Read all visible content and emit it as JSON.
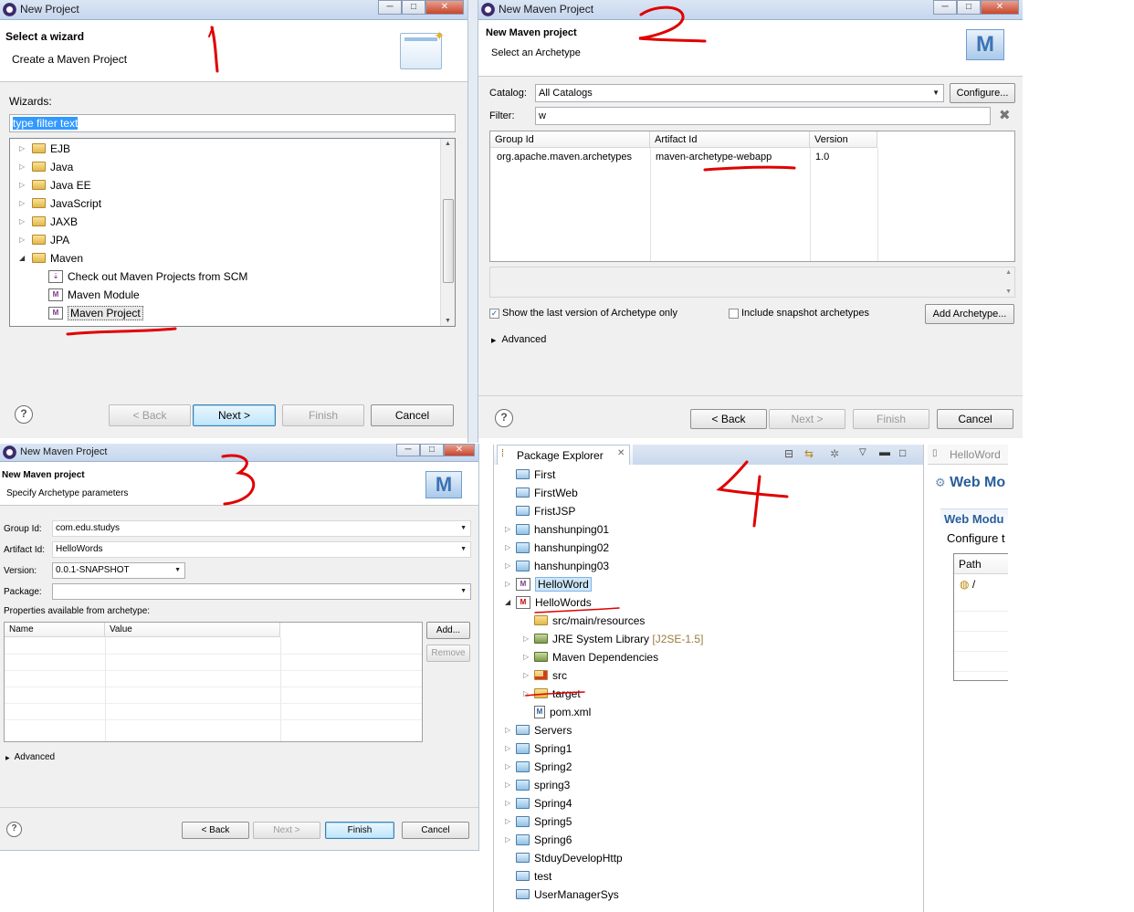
{
  "dialog1": {
    "title": "New Project",
    "banner_title": "Select a wizard",
    "banner_sub": "Create a Maven Project",
    "wizards_label": "Wizards:",
    "filter_value": "type filter text",
    "tree": [
      "EJB",
      "Java",
      "Java EE",
      "JavaScript",
      "JAXB",
      "JPA",
      "Maven"
    ],
    "maven_children": [
      "Check out Maven Projects from SCM",
      "Maven Module",
      "Maven Project"
    ],
    "buttons": {
      "back": "< Back",
      "next": "Next >",
      "finish": "Finish",
      "cancel": "Cancel"
    }
  },
  "dialog2": {
    "title": "New Maven Project",
    "banner_title": "New Maven project",
    "banner_sub": "Select an Archetype",
    "catalog_label": "Catalog:",
    "catalog_value": "All Catalogs",
    "configure": "Configure...",
    "filter_label": "Filter:",
    "filter_value": "w",
    "columns": [
      "Group Id",
      "Artifact Id",
      "Version"
    ],
    "row": {
      "group": "org.apache.maven.archetypes",
      "artifact": "maven-archetype-webapp",
      "version": "1.0"
    },
    "show_last": "Show the last version of Archetype only",
    "include_snap": "Include snapshot archetypes",
    "add_archetype": "Add Archetype...",
    "advanced": "Advanced",
    "buttons": {
      "back": "< Back",
      "next": "Next >",
      "finish": "Finish",
      "cancel": "Cancel"
    }
  },
  "dialog3": {
    "title": "New Maven Project",
    "banner_title": "New Maven project",
    "banner_sub": "Specify Archetype parameters",
    "group_label": "Group Id:",
    "group_value": "com.edu.studys",
    "artifact_label": "Artifact Id:",
    "artifact_value": "HelloWords",
    "version_label": "Version:",
    "version_value": "0.0.1-SNAPSHOT",
    "package_label": "Package:",
    "package_value": "",
    "props_label": "Properties available from archetype:",
    "columns": [
      "Name",
      "Value"
    ],
    "add": "Add...",
    "remove": "Remove",
    "advanced": "Advanced",
    "buttons": {
      "back": "< Back",
      "next": "Next >",
      "finish": "Finish",
      "cancel": "Cancel"
    }
  },
  "explorer": {
    "tab": "Package Explorer",
    "items": [
      "First",
      "FirstWeb",
      "FristJSP",
      "hanshunping01",
      "hanshunping02",
      "hanshunping03",
      "HelloWord",
      "HelloWords"
    ],
    "children": [
      "src/main/resources",
      "JRE System Library",
      "Maven Dependencies",
      "src",
      "target",
      "pom.xml"
    ],
    "jre_suffix": "[J2SE-1.5]",
    "after": [
      "Servers",
      "Spring1",
      "Spring2",
      "spring3",
      "Spring4",
      "Spring5",
      "Spring6",
      "StduyDevelopHttp",
      "test",
      "UserManagerSys"
    ]
  },
  "right_panel": {
    "tab": "HelloWord",
    "title": "Web Mo",
    "section": "Web Modu",
    "configure": "Configure t",
    "path_header": "Path",
    "path_value": "/"
  },
  "annotations": {
    "one": "1",
    "two": "2",
    "three": "3",
    "four": "4"
  }
}
